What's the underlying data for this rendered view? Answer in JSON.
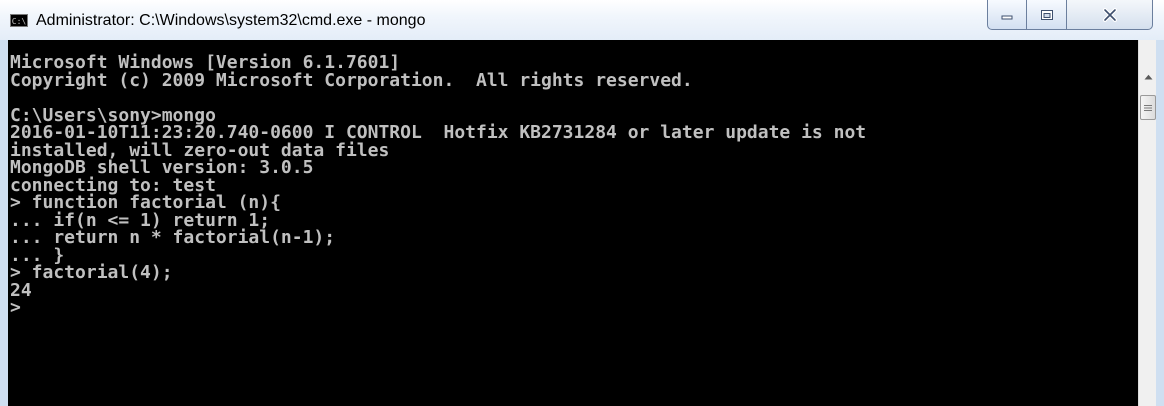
{
  "window": {
    "title": "Administrator: C:\\Windows\\system32\\cmd.exe - mongo",
    "app_icon_text": "C:\\",
    "icons": {
      "app": "cmd-icon",
      "minimize": "minimize-icon",
      "maximize": "maximize-icon",
      "close": "close-icon"
    }
  },
  "console": {
    "foreground_color": "#c0c0c0",
    "background_color": "#000000",
    "lines": [
      "Microsoft Windows [Version 6.1.7601]",
      "Copyright (c) 2009 Microsoft Corporation.  All rights reserved.",
      "",
      "C:\\Users\\sony>mongo",
      "2016-01-10T11:23:20.740-0600 I CONTROL  Hotfix KB2731284 or later update is not",
      "installed, will zero-out data files",
      "MongoDB shell version: 3.0.5",
      "connecting to: test",
      "> function factorial (n){",
      "... if(n <= 1) return 1;",
      "... return n * factorial(n-1);",
      "... }",
      "> factorial(4);",
      "24",
      ">"
    ]
  },
  "scrollbar": {
    "icons": {
      "up": "scroll-up-arrow-icon",
      "grip": "grip-icon"
    }
  }
}
